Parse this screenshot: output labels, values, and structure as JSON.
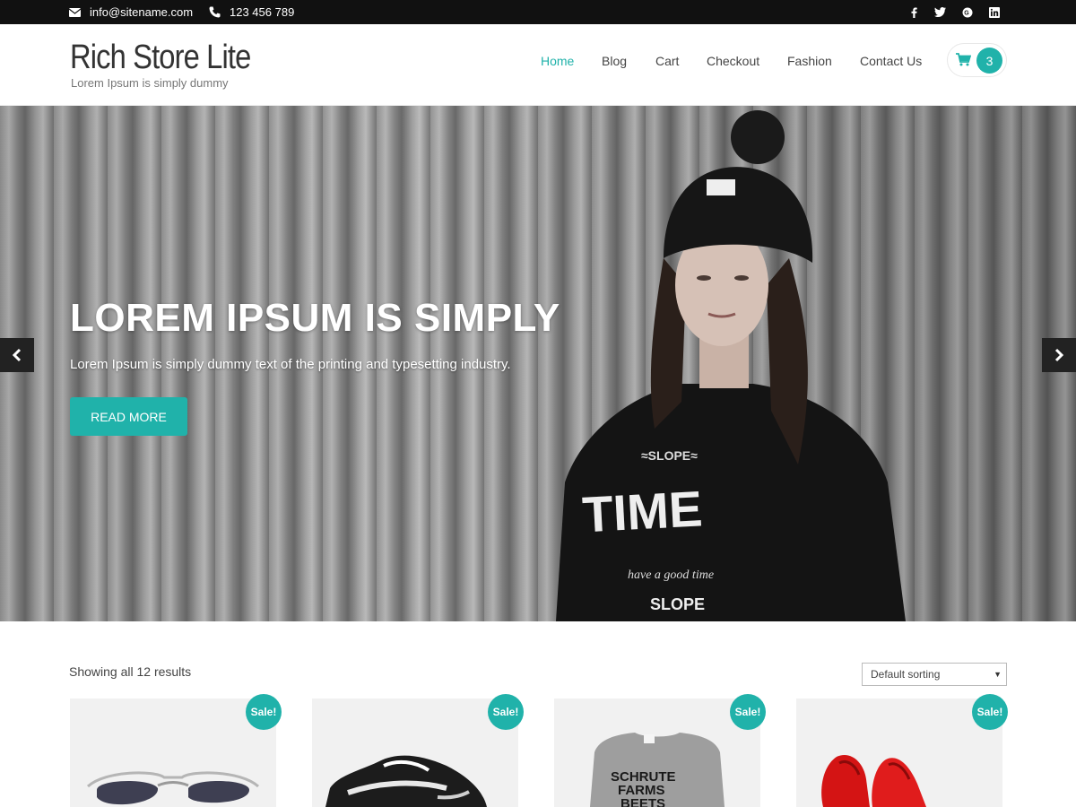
{
  "topbar": {
    "email": "info@sitename.com",
    "phone": "123 456 789",
    "social": [
      "facebook-icon",
      "twitter-icon",
      "google-plus-icon",
      "linkedin-icon"
    ]
  },
  "header": {
    "title": "Rich Store Lite",
    "tagline": "Lorem Ipsum is simply dummy",
    "nav": [
      "Home",
      "Blog",
      "Cart",
      "Checkout",
      "Fashion",
      "Contact Us"
    ],
    "active_nav": "Home",
    "cart_count": "3"
  },
  "hero": {
    "title": "LOREM IPSUM IS SIMPLY",
    "subtitle": "Lorem Ipsum is simply dummy text of the printing and typesetting industry.",
    "button": "READ MORE"
  },
  "shop": {
    "results": "Showing all 12 results",
    "sorting": "Default sorting",
    "products": [
      {
        "image": "sunglasses",
        "badge": "Sale!"
      },
      {
        "image": "sneaker",
        "badge": "Sale!"
      },
      {
        "image": "tshirt",
        "badge": "Sale!",
        "shirt_text": [
          "SCHRUTE",
          "FARMS",
          "BEETS"
        ]
      },
      {
        "image": "red-heels",
        "badge": "Sale!"
      }
    ]
  },
  "colors": {
    "accent": "#20b2aa",
    "topbar": "#111111"
  }
}
